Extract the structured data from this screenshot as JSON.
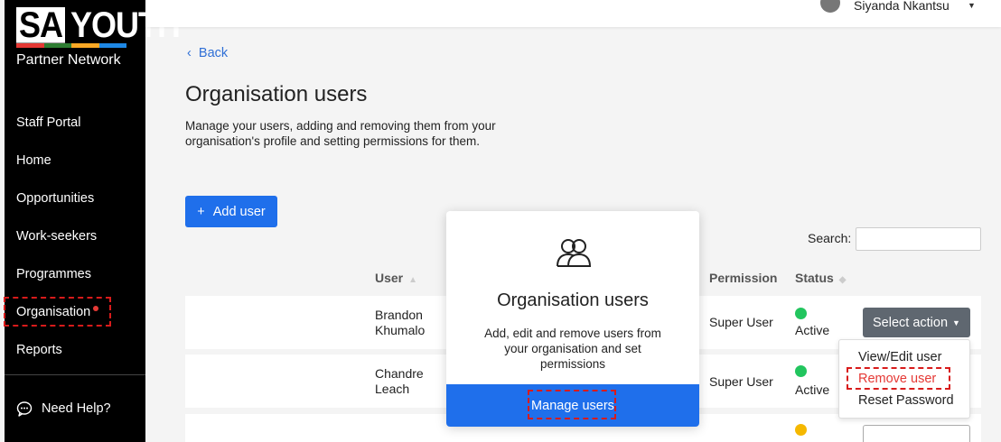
{
  "colors": {
    "sidebar_bg": "#000000",
    "primary": "#1f6feb",
    "danger": "#e53935",
    "active_green": "#22c55e",
    "pending_yellow": "#f5b800"
  },
  "brand": {
    "logo_main_sa": "SA",
    "logo_main_youth": "YOUTH",
    "logo_sub": "Partner Network",
    "stripe_colors": [
      "#e53935",
      "#2e7d32",
      "#f9a825",
      "#1e88e5"
    ]
  },
  "sidebar": {
    "items": [
      {
        "label": "Staff Portal"
      },
      {
        "label": "Home"
      },
      {
        "label": "Opportunities"
      },
      {
        "label": "Work-seekers"
      },
      {
        "label": "Programmes"
      },
      {
        "label": "Organisation",
        "notification": true
      },
      {
        "label": "Reports"
      }
    ],
    "help_label": "Need Help?"
  },
  "topbar": {
    "user_name": "Siyanda Nkantsu"
  },
  "main": {
    "back_label": "Back",
    "title": "Organisation users",
    "description": "Manage your users, adding and removing them from your organisation's profile and setting permissions for them.",
    "add_user_label": "Add user",
    "search_label": "Search:",
    "search_value": "",
    "columns": {
      "user": "User",
      "permission": "Permission",
      "status": "Status"
    },
    "rows": [
      {
        "user_first": "Brandon",
        "user_last": "Khumalo",
        "permission": "Super User",
        "status": "Active"
      },
      {
        "user_first": "Chandre",
        "user_last": "Leach",
        "permission": "Super User",
        "status": "Active"
      }
    ],
    "select_action_label": "Select action",
    "dropdown_items": [
      "View/Edit user",
      "Remove user",
      "Reset Password"
    ]
  },
  "popup": {
    "title": "Organisation users",
    "description": "Add, edit and remove users from your organisation and set permissions",
    "button_label": "Manage users"
  }
}
